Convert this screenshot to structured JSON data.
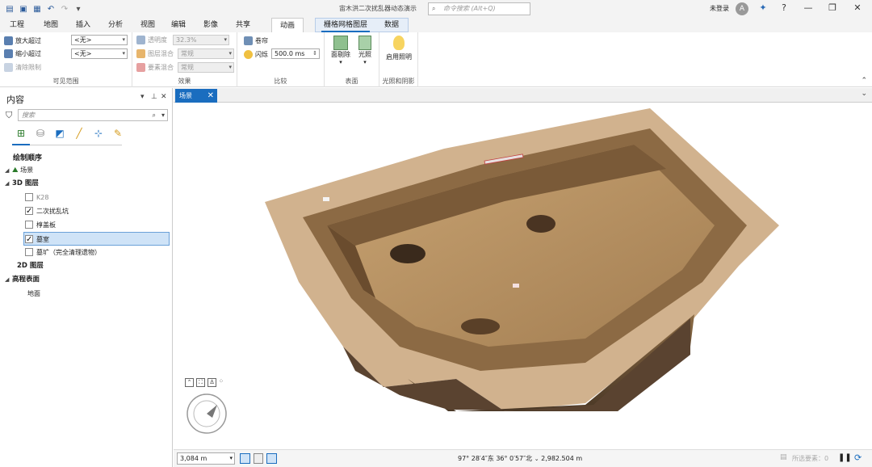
{
  "title_bar": {
    "title": "宙木洪二次扰乱器动态演示",
    "search_placeholder": "命令搜索 (Alt+Q)",
    "user": "未登录",
    "avatar_letter": "A",
    "help": "?",
    "minimize": "—",
    "restore": "❐",
    "close": "✕"
  },
  "menu": {
    "tabs": [
      "工程",
      "地图",
      "插入",
      "分析",
      "视图",
      "编辑",
      "影像",
      "共享",
      "动画"
    ],
    "contextual_tabs": [
      "栅格网格图层",
      "数据"
    ],
    "active_tab": "栅格网格图层"
  },
  "ribbon": {
    "visible_range": {
      "label": "可见范围",
      "zoom_in_beyond": "放大超过",
      "zoom_out_beyond": "缩小超过",
      "clear_limits": "清除限制",
      "zoom_in_value": "<无>",
      "zoom_out_value": "<无>"
    },
    "effects": {
      "label": "效果",
      "transparency": "透明度",
      "transparency_value": "32.3%",
      "layer_blend": "图层混合",
      "layer_blend_value": "常规",
      "feature_blend": "要素混合",
      "feature_blend_value": "常规"
    },
    "compare": {
      "label": "比较",
      "swipe": "卷帘",
      "flicker": "闪烁",
      "flicker_value": "500.0",
      "flicker_unit": "ms"
    },
    "surface": {
      "label": "表面",
      "face_culling": "面剔除",
      "lighting": "光照"
    },
    "illumination": {
      "label": "光照和阴影",
      "enable_lighting": "启用照明"
    }
  },
  "contents": {
    "title": "内容",
    "search_placeholder": "搜索",
    "drawing_order": "绘制顺序",
    "tree": [
      {
        "label": "场景",
        "indent": 0,
        "type": "scene",
        "expand": true
      },
      {
        "label": "3D 图层",
        "indent": 1,
        "type": "group",
        "bold": true,
        "expand": true
      },
      {
        "label": "K28",
        "indent": 2,
        "type": "layer",
        "checked": false,
        "dim": true
      },
      {
        "label": "二次扰乱坑",
        "indent": 2,
        "type": "layer",
        "checked": true
      },
      {
        "label": "椁盖板",
        "indent": 2,
        "type": "layer",
        "checked": false
      },
      {
        "label": "墓室",
        "indent": 2,
        "type": "layer",
        "checked": true,
        "selected": true
      },
      {
        "label": "墓圹（完全清理遗物）",
        "indent": 2,
        "type": "layer",
        "checked": false
      },
      {
        "label": "2D 图层",
        "indent": 1,
        "type": "group",
        "bold": true,
        "expand": false
      },
      {
        "label": "高程表面",
        "indent": 0,
        "type": "group",
        "bold": true,
        "expand": true
      },
      {
        "label": "地面",
        "indent": 2,
        "type": "item"
      }
    ]
  },
  "map_view": {
    "tab_label": "场景",
    "tab_close": "✕",
    "scale": "3,084 m",
    "coordinates": "97° 28′4″东  36° 0′57″北",
    "elevation": "2,982.504 m",
    "selected_features": "所选要素：0"
  },
  "colors": {
    "accent": "#1a6dbf",
    "soil_dark": "#6b4a2a",
    "soil_light": "#b58a55"
  }
}
